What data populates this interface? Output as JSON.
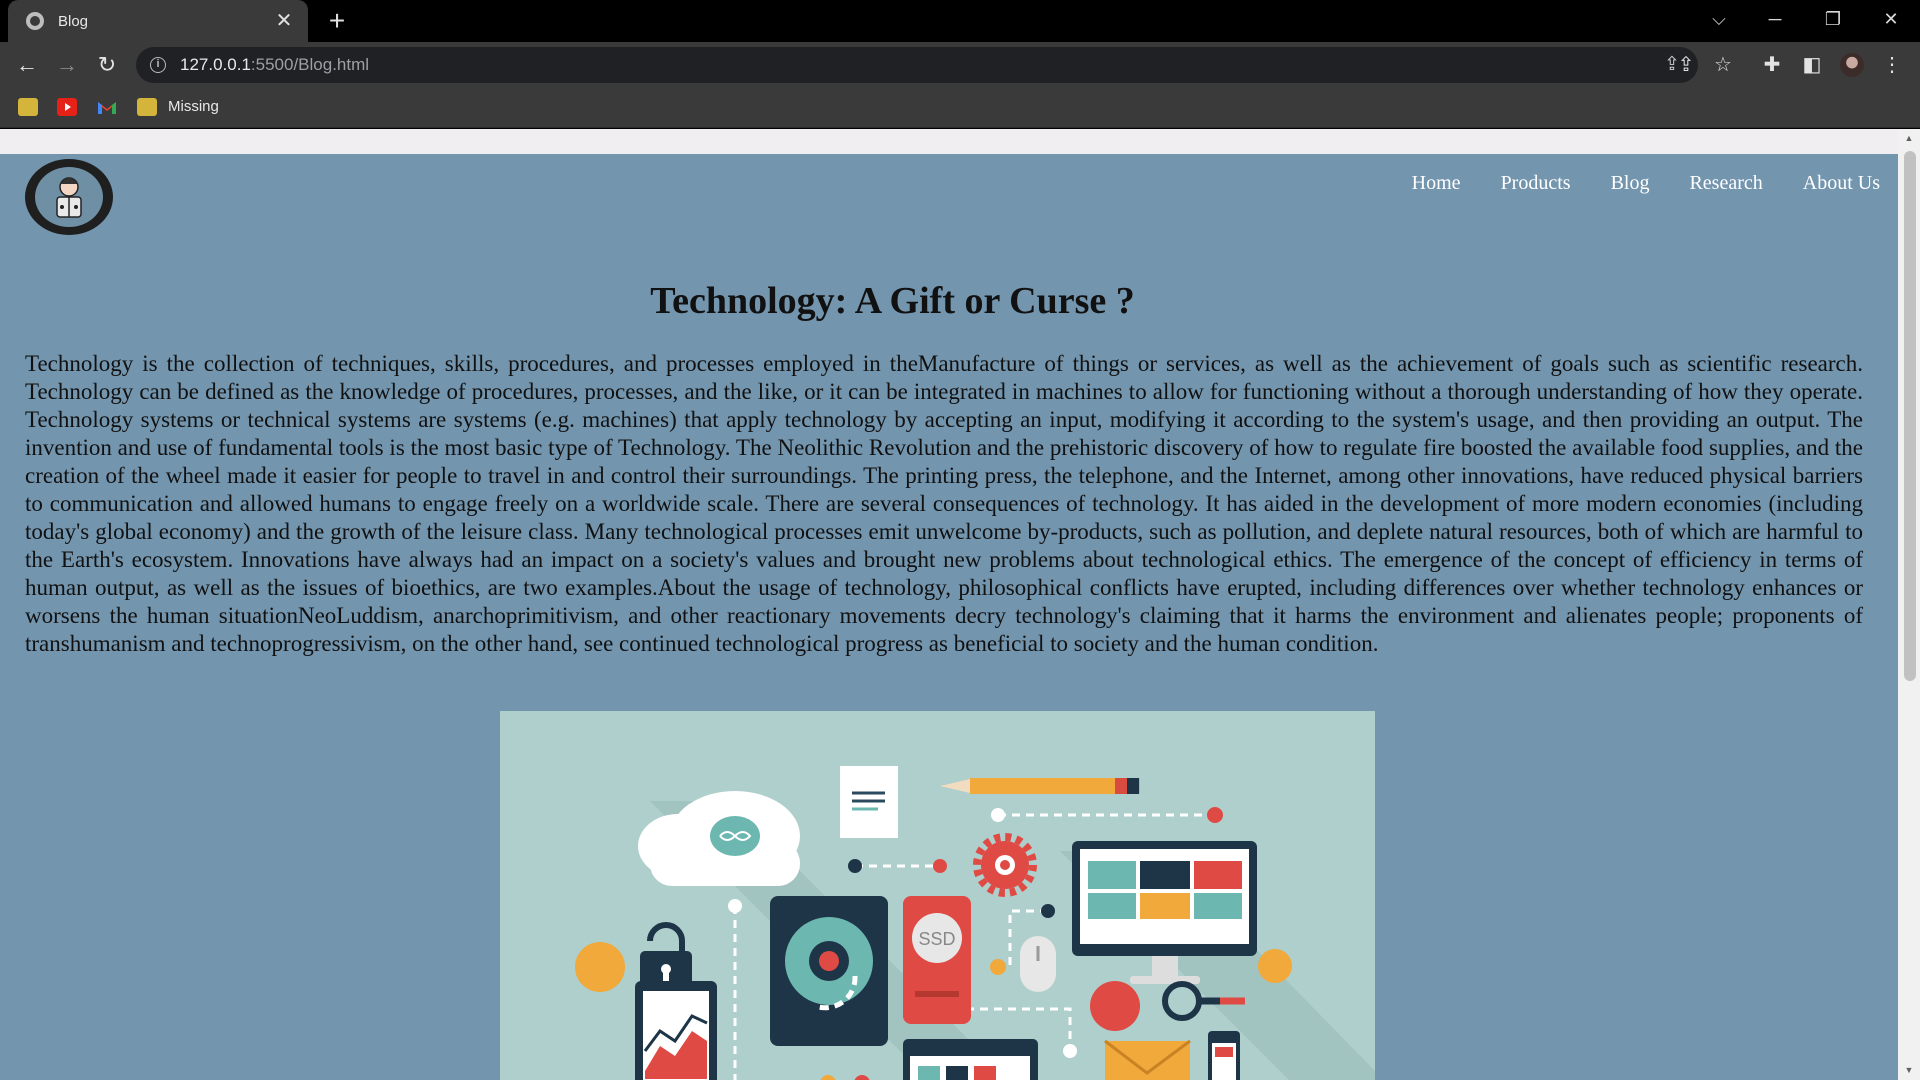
{
  "browser": {
    "tab": {
      "title": "Blog",
      "close": "✕"
    },
    "new_tab": "+",
    "window_controls": {
      "dropdown": "⌵",
      "minimize": "─",
      "restore": "❐",
      "close": "✕"
    },
    "url": {
      "host": "127.0.0.1",
      "rest": ":5500/Blog.html"
    },
    "bookmarks": {
      "missing_label": "Missing"
    }
  },
  "colors": {
    "page_background": "#7395ae",
    "browser_toolbar": "#3a3a3a",
    "hero_background": "#aecfcc"
  },
  "site": {
    "nav": [
      "Home",
      "Products",
      "Blog",
      "Research",
      "About Us"
    ],
    "title": "Technology: A Gift or Curse ?",
    "body": "Technology is the collection of techniques, skills, procedures, and processes employed in theManufacture of things or services, as well as the achievement of goals such as scientific research. Technology can be defined as the knowledge of procedures, processes, and the like, or it can be integrated in machines to allow for functioning without a thorough understanding of how they operate. Technology systems or technical systems are systems (e.g. machines) that apply technology by accepting an input, modifying it according to the system's usage, and then providing an output. The invention and use of fundamental tools is the most basic type of Technology. The Neolithic Revolution and the prehistoric discovery of how to regulate fire boosted the available food supplies, and the creation of the wheel made it easier for people to travel in and control their surroundings. The printing press, the telephone, and the Internet, among other innovations, have reduced physical barriers to communication and allowed humans to engage freely on a worldwide scale. There are several consequences of technology. It has aided in the development of more modern economies (including today's global economy) and the growth of the leisure class. Many technological processes emit unwelcome by-products, such as pollution, and deplete natural resources, both of which are harmful to the Earth's ecosystem. Innovations have always had an impact on a society's values and brought new problems about technological ethics. The emergence of the concept of efficiency in terms of human output, as well as the issues of bioethics, are two examples.About the usage of technology, philosophical conflicts have erupted, including differences over whether technology enhances or worsens the human situationNeoLuddism, anarchoprimitivism, and other reactionary movements decry technology's claiming that it harms the environment and alienates people; proponents of transhumanism and technoprogressivism, on the other hand, see continued technological progress as beneficial to society and the human condition.",
    "hero_ssd_label": "SSD"
  }
}
